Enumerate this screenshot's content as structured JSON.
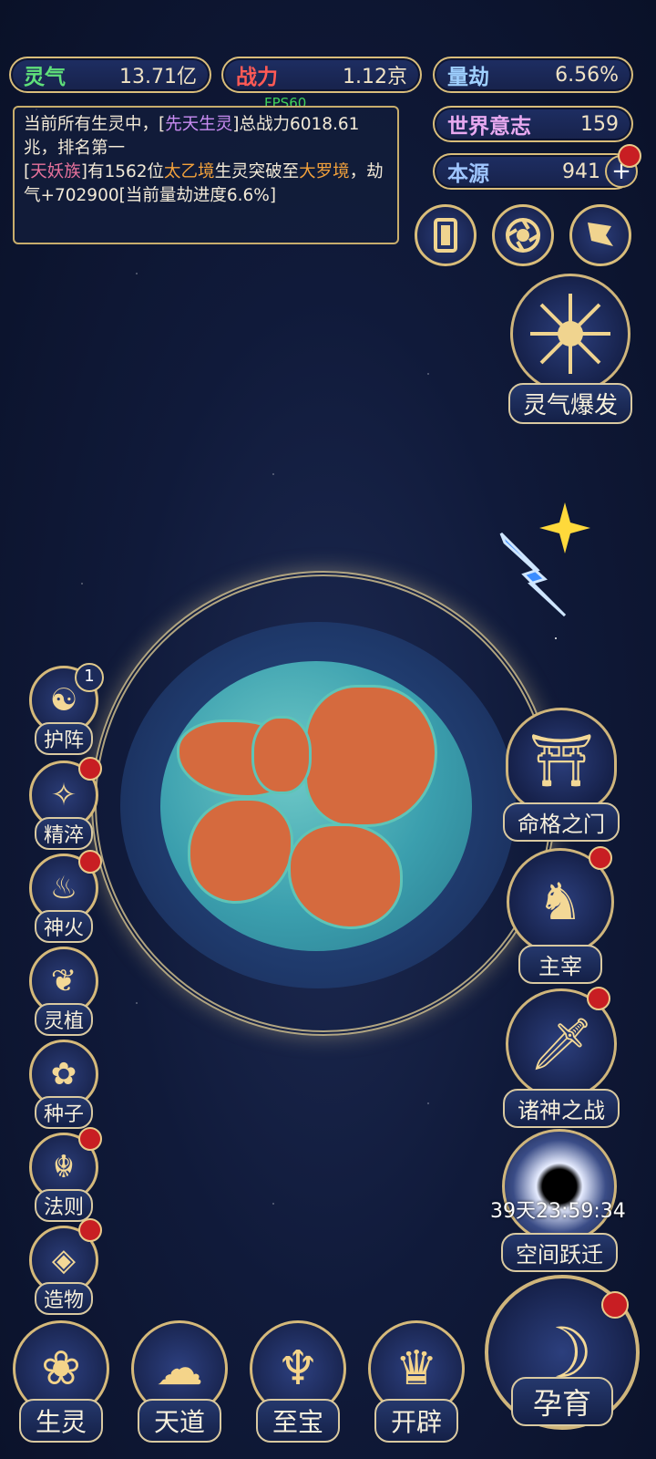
{
  "stats": {
    "lingqi": {
      "label": "灵气",
      "value": "13.71亿",
      "color": "#5fe07a"
    },
    "zhanli": {
      "label": "战力",
      "value": "1.12京",
      "color": "#ff5a55"
    },
    "liangjie": {
      "label": "量劫",
      "value": "6.56%",
      "color": "#9fd0ff"
    },
    "shijie": {
      "label": "世界意志",
      "value": "159",
      "color": "#e8a9f0"
    },
    "benyuan": {
      "label": "本源",
      "value": "941",
      "color": "#9fc6ff"
    }
  },
  "fps": "FPS60",
  "log": {
    "line1_a": "当前所有生灵中，[",
    "line1_b": "先天生灵",
    "line1_c": "]总战力6018.61兆，排名第一",
    "line2_a": "[",
    "line2_b": "天妖族",
    "line2_c": "]有1562位",
    "line2_d": "太乙境",
    "line2_e": "生灵突破至",
    "line2_f": "大罗境",
    "line2_g": "，劫气+702900[当前量劫进度6.6%]"
  },
  "right_buttons": {
    "burst": "灵气爆发",
    "fate_gate": "命格之门",
    "ruler": "主宰",
    "gods_war": "诸神之战",
    "space_jump": "空间跃迁",
    "space_timer": "39天23:59:34",
    "nurture": "孕育"
  },
  "left_buttons": [
    {
      "label": "护阵",
      "glyph": "☯"
    },
    {
      "label": "精淬",
      "glyph": "✧"
    },
    {
      "label": "神火",
      "glyph": "♨"
    },
    {
      "label": "灵植",
      "glyph": "❦"
    },
    {
      "label": "种子",
      "glyph": "✿"
    },
    {
      "label": "法则",
      "glyph": "☬"
    },
    {
      "label": "造物",
      "glyph": "◈"
    }
  ],
  "protect_badge": "1",
  "bottom_nav": [
    {
      "label": "生灵",
      "glyph": "❀"
    },
    {
      "label": "天道",
      "glyph": "☁"
    },
    {
      "label": "至宝",
      "glyph": "♆"
    },
    {
      "label": "开辟",
      "glyph": "♛"
    }
  ]
}
